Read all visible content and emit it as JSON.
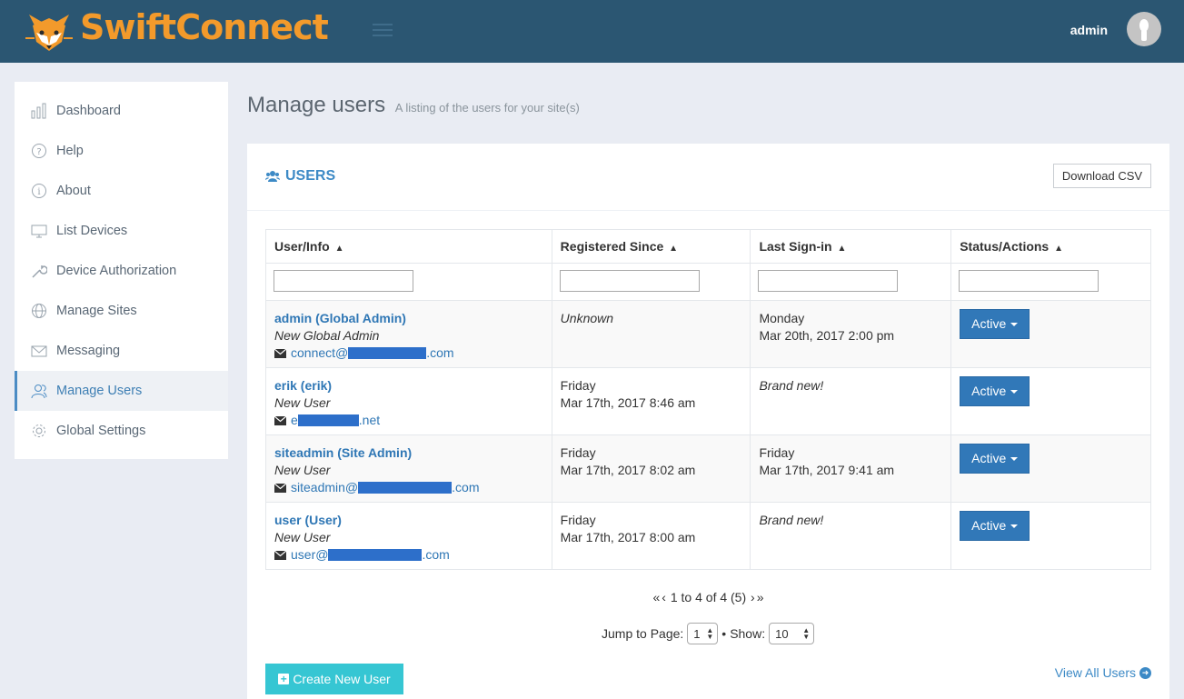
{
  "app": {
    "brand": "SwiftConnect",
    "user": "admin"
  },
  "sidebar": {
    "items": [
      {
        "label": "Dashboard",
        "icon": "bar-chart-icon"
      },
      {
        "label": "Help",
        "icon": "question-circle-icon"
      },
      {
        "label": "About",
        "icon": "info-circle-icon"
      },
      {
        "label": "List Devices",
        "icon": "monitor-icon"
      },
      {
        "label": "Device Authorization",
        "icon": "wrench-icon"
      },
      {
        "label": "Manage Sites",
        "icon": "globe-icon"
      },
      {
        "label": "Messaging",
        "icon": "envelope-icon"
      },
      {
        "label": "Manage Users",
        "icon": "users-icon",
        "active": true
      },
      {
        "label": "Global Settings",
        "icon": "gear-icon"
      }
    ]
  },
  "page": {
    "title": "Manage users",
    "subtitle": "A listing of the users for your site(s)"
  },
  "panel": {
    "title": "USERS",
    "download_label": "Download CSV",
    "columns": [
      "User/Info",
      "Registered Since",
      "Last Sign-in",
      "Status/Actions"
    ],
    "rows": [
      {
        "name": "admin (Global Admin)",
        "role": "New Global Admin",
        "email_prefix": "connect@",
        "email_suffix": ".com",
        "registered": "Unknown",
        "registered_line2": "",
        "last_signin": "Monday",
        "last_signin_line2": "Mar 20th, 2017 2:00 pm",
        "status": "Active"
      },
      {
        "name": "erik (erik)",
        "role": "New User",
        "email_prefix": "e",
        "email_suffix": ".net",
        "registered": "Friday",
        "registered_line2": "Mar 17th, 2017 8:46 am",
        "last_signin": "Brand new!",
        "last_signin_line2": "",
        "status": "Active"
      },
      {
        "name": "siteadmin (Site Admin)",
        "role": "New User",
        "email_prefix": "siteadmin@",
        "email_suffix": ".com",
        "registered": "Friday",
        "registered_line2": "Mar 17th, 2017 8:02 am",
        "last_signin": "Friday",
        "last_signin_line2": "Mar 17th, 2017 9:41 am",
        "status": "Active"
      },
      {
        "name": "user (User)",
        "role": "New User",
        "email_prefix": "user@",
        "email_suffix": ".com",
        "registered": "Friday",
        "registered_line2": "Mar 17th, 2017 8:00 am",
        "last_signin": "Brand new!",
        "last_signin_line2": "",
        "status": "Active"
      }
    ],
    "pager_text": "1 to 4 of 4 (5)",
    "jump_label": "Jump to Page:",
    "page_value": "1",
    "show_label": "Show:",
    "show_value": "10",
    "create_label": "Create New User",
    "view_all_label": "View All Users"
  },
  "colors": {
    "header": "#2b5672",
    "brand": "#f39a2b",
    "accent": "#3d8ac6",
    "button": "#3178b8",
    "create": "#36c6d3",
    "redaction": "#2d6fca"
  }
}
